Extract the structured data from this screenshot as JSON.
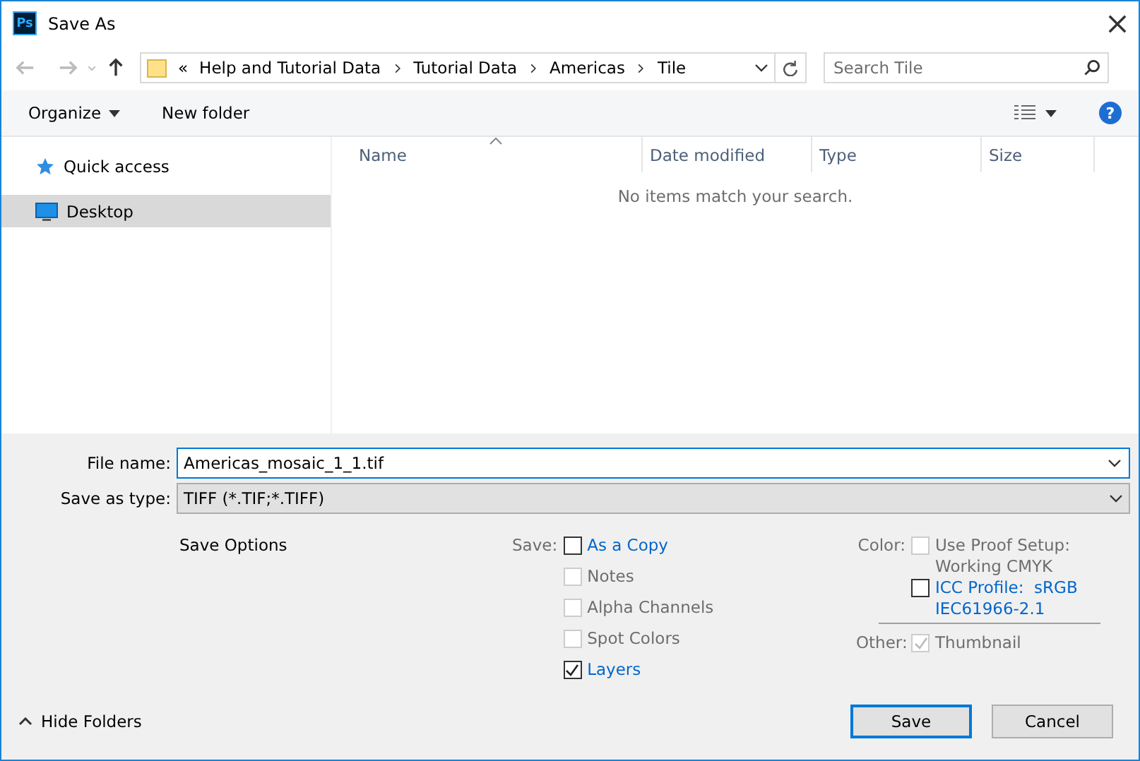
{
  "window": {
    "title": "Save As",
    "app_icon": "Ps"
  },
  "nav": {
    "root_marker": "«",
    "path": [
      "Help and Tutorial Data",
      "Tutorial Data",
      "Americas",
      "Tile"
    ],
    "search": {
      "placeholder": "Search Tile"
    }
  },
  "toolbar": {
    "organize": "Organize",
    "new_folder": "New folder",
    "help": "?"
  },
  "sidebar": {
    "items": [
      {
        "label": "Quick access",
        "kind": "star",
        "selected": false
      },
      {
        "label": "Desktop",
        "kind": "monitor",
        "selected": true
      }
    ]
  },
  "file_list": {
    "columns": [
      "Name",
      "Date modified",
      "Type",
      "Size"
    ],
    "empty_message": "No items match your search."
  },
  "form": {
    "file_name": {
      "label": "File name:",
      "value": "Americas_mosaic_1_1.tif"
    },
    "save_as_type": {
      "label": "Save as type:",
      "value": "TIFF (*.TIF;*.TIFF)"
    }
  },
  "save_options": {
    "title": "Save Options",
    "save": {
      "label": "Save:",
      "options": [
        {
          "label": "As a Copy",
          "checked": false,
          "disabled": false
        },
        {
          "label": "Notes",
          "checked": false,
          "disabled": true
        },
        {
          "label": "Alpha Channels",
          "checked": false,
          "disabled": true
        },
        {
          "label": "Spot Colors",
          "checked": false,
          "disabled": true
        },
        {
          "label": "Layers",
          "checked": true,
          "disabled": false
        }
      ]
    },
    "color": {
      "label": "Color:",
      "options": [
        {
          "label": "Use Proof Setup: Working CMYK",
          "checked": false,
          "disabled": true
        },
        {
          "label": "ICC Profile:  sRGB IEC61966-2.1",
          "checked": false,
          "disabled": false
        }
      ]
    },
    "other": {
      "label": "Other:",
      "options": [
        {
          "label": "Thumbnail",
          "checked": true,
          "disabled": true
        }
      ]
    }
  },
  "footer": {
    "hide_folders": "Hide Folders",
    "buttons": [
      {
        "label": "Save",
        "default": true
      },
      {
        "label": "Cancel",
        "default": false
      }
    ]
  }
}
